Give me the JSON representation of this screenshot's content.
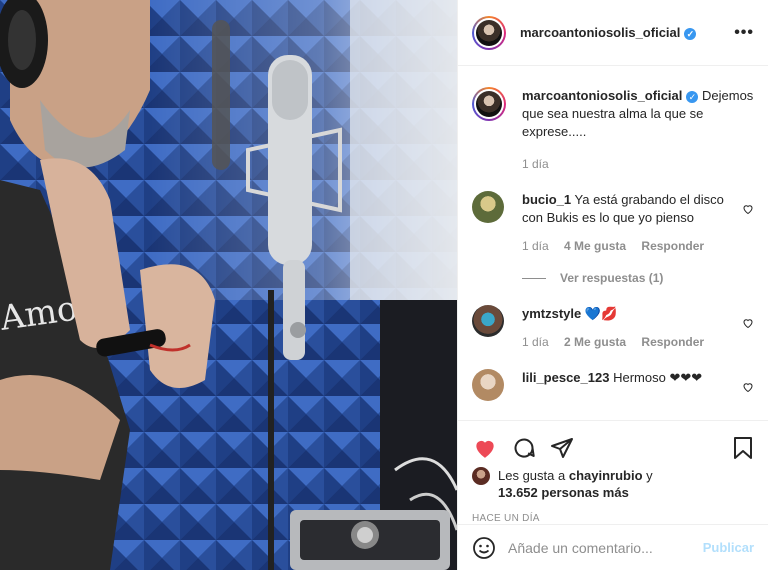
{
  "post": {
    "username": "marcoantoniosolis_oficial",
    "verified_mark": "✓",
    "more_label": "•••"
  },
  "caption": {
    "username": "marcoantoniosolis_oficial",
    "text": "Dejemos que sea nuestra alma la que se exprese.....",
    "time": "1 día"
  },
  "comments": [
    {
      "username": "bucio_1",
      "text": "Ya está grabando el disco con Bukis es lo que yo pienso",
      "time": "1 día",
      "likes": "4 Me gusta",
      "reply": "Responder",
      "view_replies": "Ver respuestas (1)"
    },
    {
      "username": "ymtzstyle",
      "text": "💙💋",
      "time": "1 día",
      "likes": "2 Me gusta",
      "reply": "Responder"
    },
    {
      "username": "lili_pesce_123",
      "text": "Hermoso ❤❤❤"
    }
  ],
  "likes_line": {
    "prefix": "Les gusta a",
    "user": "chayinrubio",
    "suffix": "y",
    "count": "13.652 personas más"
  },
  "post_time": "HACE UN DÍA",
  "add_comment": {
    "placeholder": "Añade un comentario...",
    "publish": "Publicar"
  },
  "colors": {
    "like_red": "#ed4956",
    "verified_blue": "#3897f0",
    "publish_disabled": "#b2dffc"
  },
  "icons": [
    "heart-icon",
    "comment-icon",
    "share-icon",
    "bookmark-icon",
    "emoji-icon",
    "more-options-icon",
    "verified-icon"
  ]
}
